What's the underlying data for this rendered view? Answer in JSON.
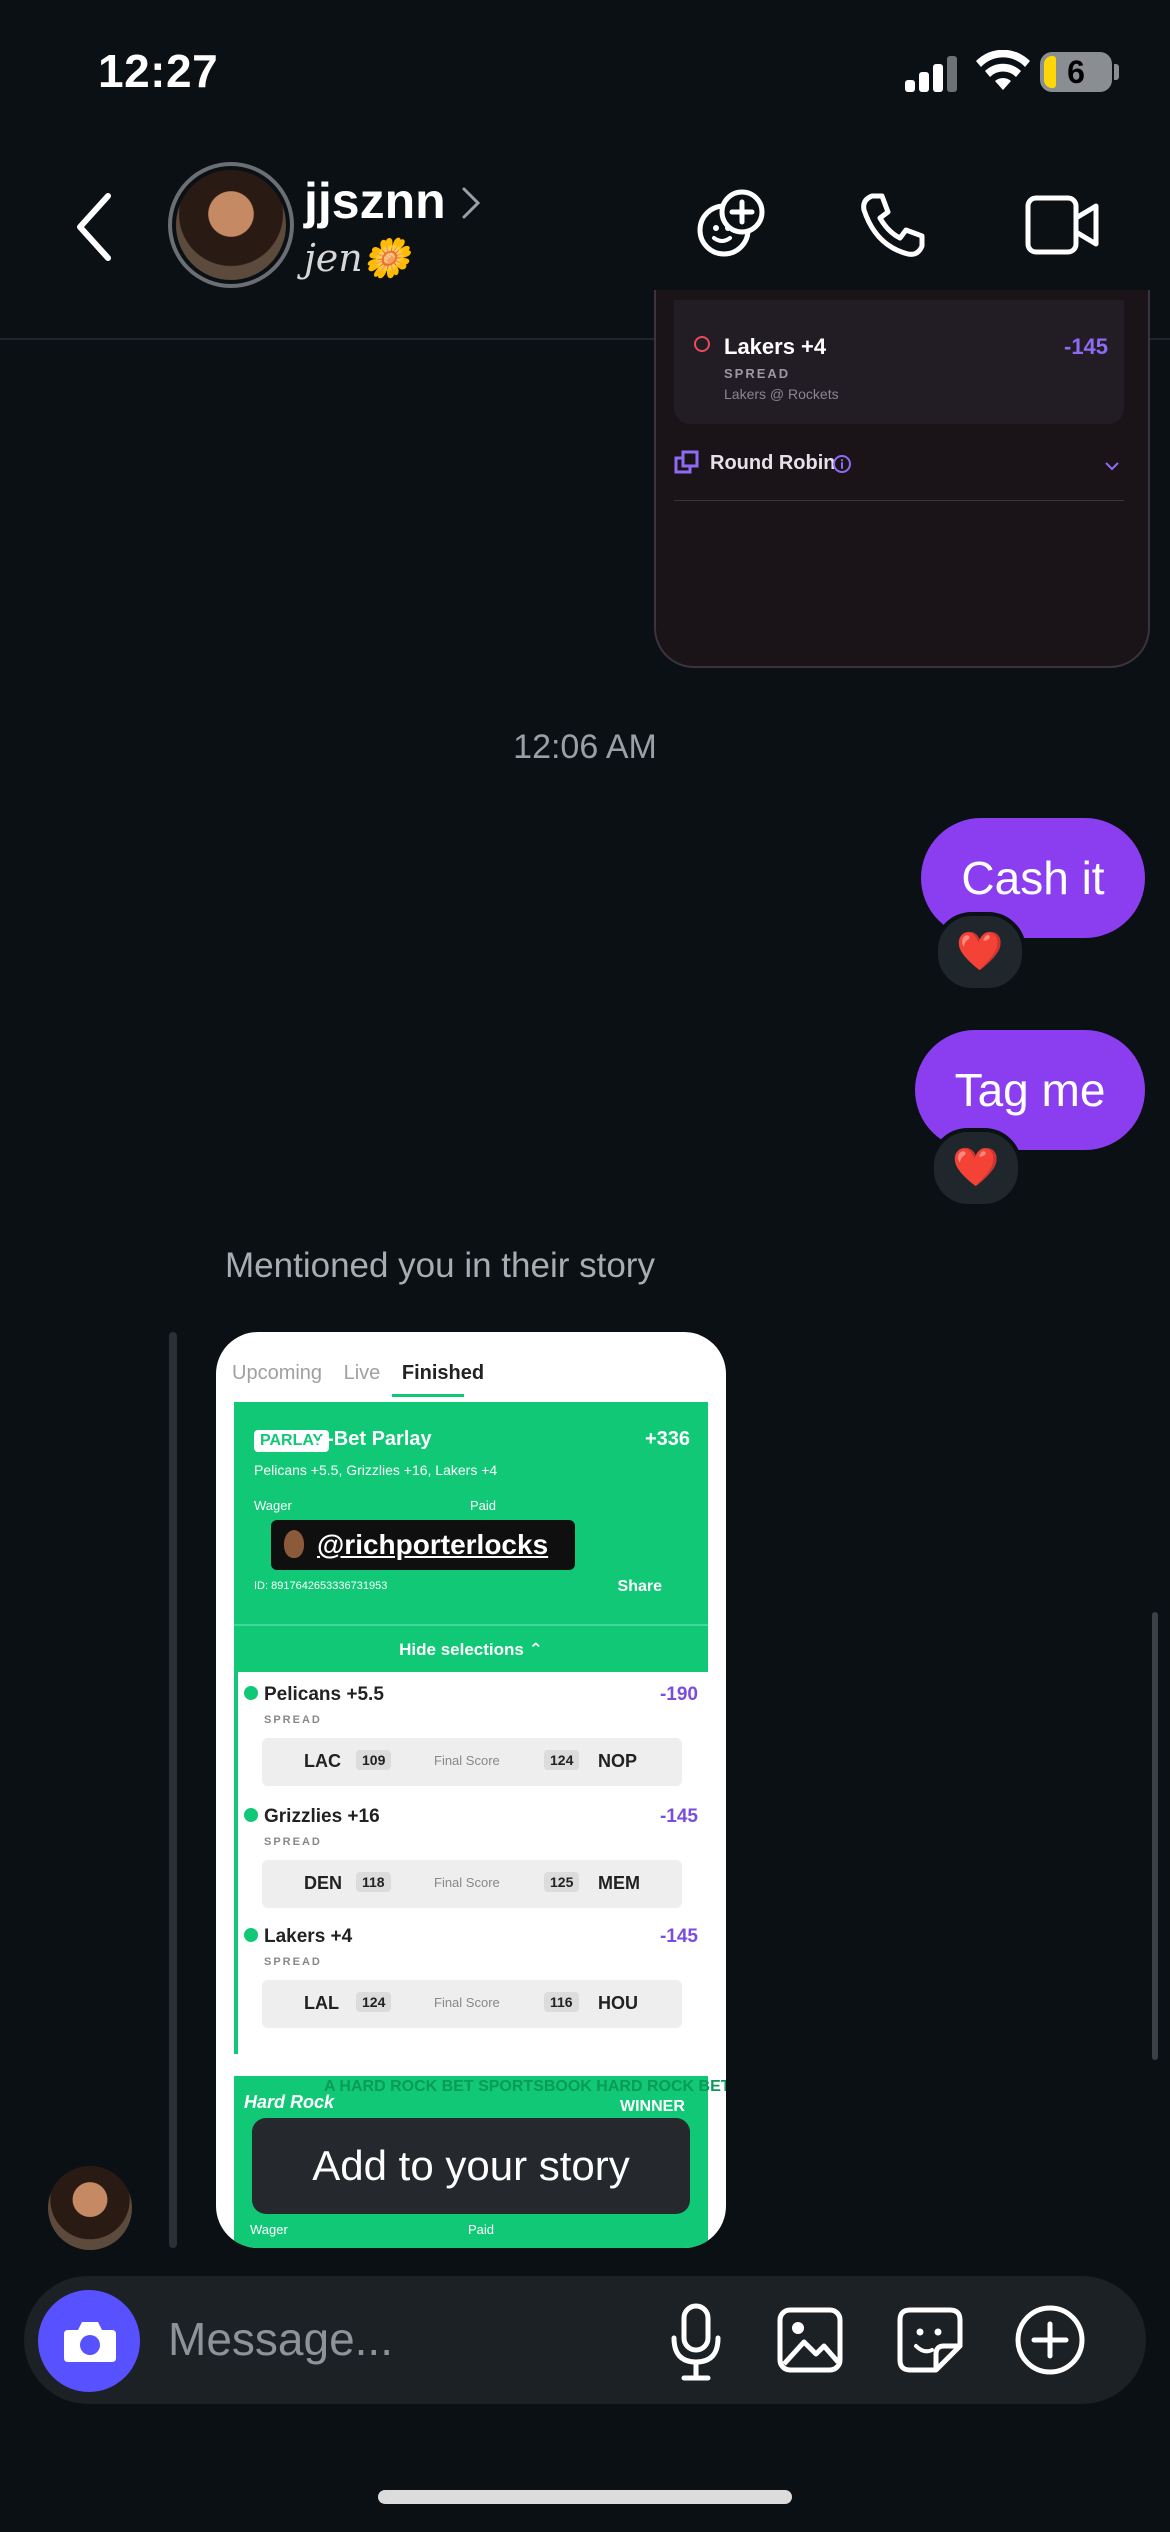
{
  "status": {
    "time": "12:27",
    "battery": "6"
  },
  "header": {
    "username": "jjsznn",
    "subname": "jen🌼"
  },
  "bet_card": {
    "leg_title": "Lakers +4",
    "leg_odds": "-145",
    "leg_type": "SPREAD",
    "leg_game": "Lakers @ Rockets",
    "round_robin": "Round Robin"
  },
  "messages": {
    "timestamp": "12:06 AM",
    "sent": [
      {
        "text": "Cash it",
        "reaction": "❤️"
      },
      {
        "text": "Tag me",
        "reaction": "❤️"
      }
    ],
    "mention_notice": "Mentioned you in their story"
  },
  "story": {
    "tabs": [
      "Upcoming",
      "Live",
      "Finished"
    ],
    "active_tab": "Finished",
    "parlay_tag": "PARLAY",
    "parlay_title": "3-Bet Parlay",
    "parlay_odds": "+336",
    "parlay_legs": "Pelicans +5.5, Grizzlies +16, Lakers +4",
    "wager_label": "Wager",
    "paid_label": "Paid",
    "bet_id": "ID: 8917642653336731953",
    "share_label": "Share",
    "mention_sticker": "@richporterlocks",
    "hide_selections": "Hide selections ⌃",
    "legs": [
      {
        "name": "Pelicans +5.5",
        "odds": "-190",
        "type": "SPREAD",
        "team1": "LAC",
        "score1": "109",
        "final": "Final Score",
        "score2": "124",
        "team2": "NOP"
      },
      {
        "name": "Grizzlies +16",
        "odds": "-145",
        "type": "SPREAD",
        "team1": "DEN",
        "score1": "118",
        "final": "Final Score",
        "score2": "125",
        "team2": "MEM"
      },
      {
        "name": "Lakers +4",
        "odds": "-145",
        "type": "SPREAD",
        "team1": "LAL",
        "score1": "124",
        "final": "Final Score",
        "score2": "116",
        "team2": "HOU"
      }
    ],
    "banner_stripe": "A HARD ROCK BET SPORTSBOOK HARD ROCK BET SPORTSBOOK",
    "banner_winner": "WINNER",
    "banner_logo": "Hard Rock",
    "wager_label_2": "Wager",
    "paid_label_2": "Paid",
    "add_to_story": "Add to your story"
  },
  "composer": {
    "placeholder": "Message..."
  },
  "colors": {
    "accent": "#8b3ef0",
    "camera": "#5851ff",
    "green": "#10c876",
    "odds": "#7a4de0"
  }
}
